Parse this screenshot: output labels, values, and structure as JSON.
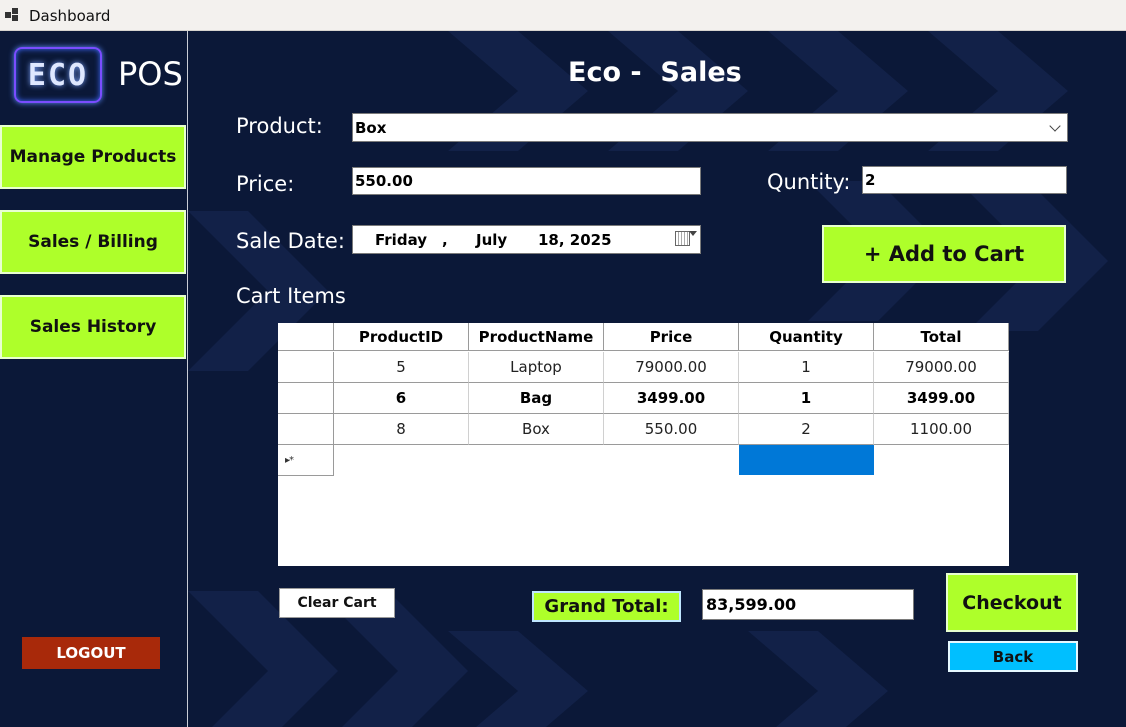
{
  "window": {
    "title": "Dashboard",
    "icon": "app-window-icon"
  },
  "sidebar": {
    "logo_text": "ECO",
    "logo_suffix": "POS",
    "items": [
      {
        "label": "Manage Products"
      },
      {
        "label": "Sales / Billing"
      },
      {
        "label": "Sales History"
      }
    ],
    "logout_label": "LOGOUT"
  },
  "main": {
    "title": "Eco -  Sales",
    "product": {
      "label": "Product:",
      "value": "Box"
    },
    "price": {
      "label": "Price:",
      "value": "550.00"
    },
    "quantity": {
      "label": "Quntity:",
      "value": "2"
    },
    "sale_date": {
      "label": "Sale Date:",
      "weekday": "Friday",
      "sep": ",",
      "month": "July",
      "day_year": "18, 2025"
    },
    "add_button": "+ Add to Cart",
    "cart_title": "Cart Items",
    "cart": {
      "columns": [
        "ProductID",
        "ProductName",
        "Price",
        "Quantity",
        "Total"
      ],
      "rows": [
        [
          "5",
          "Laptop",
          "79000.00",
          "1",
          "79000.00"
        ],
        [
          "6",
          "Bag",
          "3499.00",
          "1",
          "3499.00"
        ],
        [
          "8",
          "Box",
          "550.00",
          "2",
          "1100.00"
        ]
      ],
      "new_row_marker": "▸*"
    },
    "clear_button": "Clear Cart",
    "grand_total": {
      "label": "Grand Total:",
      "value": "83,599.00"
    },
    "checkout_button": "Checkout",
    "back_button": "Back"
  },
  "colors": {
    "background": "#0b1838",
    "accent": "#aeff2a",
    "back": "#00bfff",
    "logout": "#a8290a",
    "selection": "#0078d7"
  }
}
